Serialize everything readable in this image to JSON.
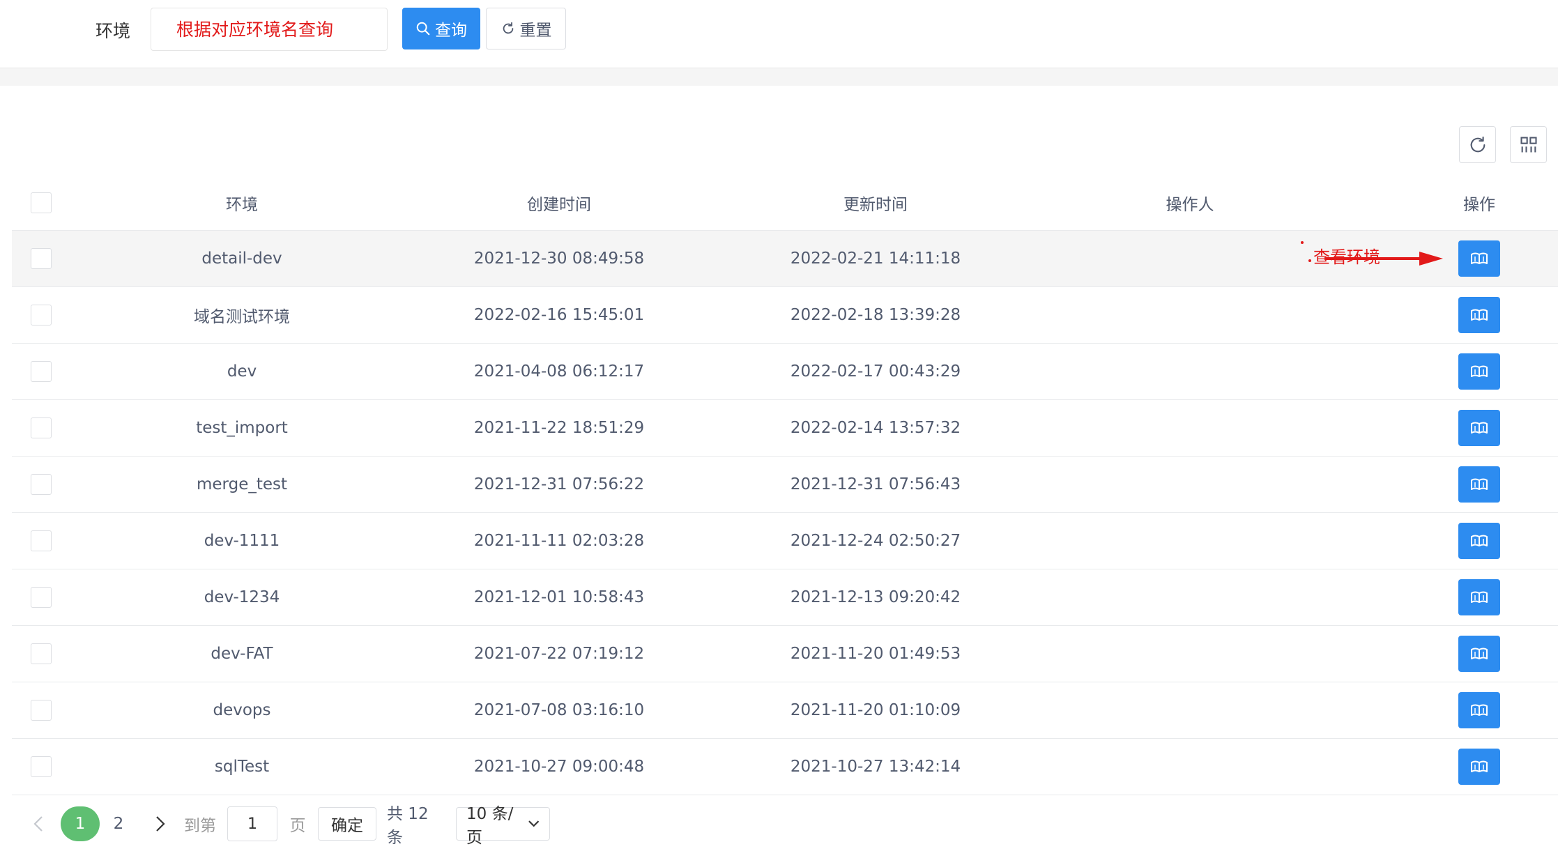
{
  "search": {
    "label": "环境",
    "placeholder": "根据对应环境名查询",
    "query_label": "查询",
    "reset_label": "重置"
  },
  "table": {
    "headers": {
      "env": "环境",
      "created": "创建时间",
      "updated": "更新时间",
      "operator": "操作人",
      "action": "操作"
    },
    "rows": [
      {
        "env": "detail-dev",
        "created": "2021-12-30 08:49:58",
        "updated": "2022-02-21 14:11:18",
        "operator": ""
      },
      {
        "env": "域名测试环境",
        "created": "2022-02-16 15:45:01",
        "updated": "2022-02-18 13:39:28",
        "operator": ""
      },
      {
        "env": "dev",
        "created": "2021-04-08 06:12:17",
        "updated": "2022-02-17 00:43:29",
        "operator": ""
      },
      {
        "env": "test_import",
        "created": "2021-11-22 18:51:29",
        "updated": "2022-02-14 13:57:32",
        "operator": ""
      },
      {
        "env": "merge_test",
        "created": "2021-12-31 07:56:22",
        "updated": "2021-12-31 07:56:43",
        "operator": ""
      },
      {
        "env": "dev-1111",
        "created": "2021-11-11 02:03:28",
        "updated": "2021-12-24 02:50:27",
        "operator": ""
      },
      {
        "env": "dev-1234",
        "created": "2021-12-01 10:58:43",
        "updated": "2021-12-13 09:20:42",
        "operator": ""
      },
      {
        "env": "dev-FAT",
        "created": "2021-07-22 07:19:12",
        "updated": "2021-11-20 01:49:53",
        "operator": ""
      },
      {
        "env": "devops",
        "created": "2021-07-08 03:16:10",
        "updated": "2021-11-20 01:10:09",
        "operator": ""
      },
      {
        "env": "sqlTest",
        "created": "2021-10-27 09:00:48",
        "updated": "2021-10-27 13:42:14",
        "operator": ""
      }
    ]
  },
  "annotation": {
    "text": "查看环境"
  },
  "pagination": {
    "current_page": "1",
    "page_2": "2",
    "goto_label": "到第",
    "jump_value": "1",
    "page_label": "页",
    "confirm_label": "确定",
    "total_label": "共 12 条",
    "page_size_label": "10 条/页"
  },
  "colors": {
    "primary": "#2d8cf0",
    "active_page": "#5fbf72",
    "annotation": "#e21a1a"
  }
}
